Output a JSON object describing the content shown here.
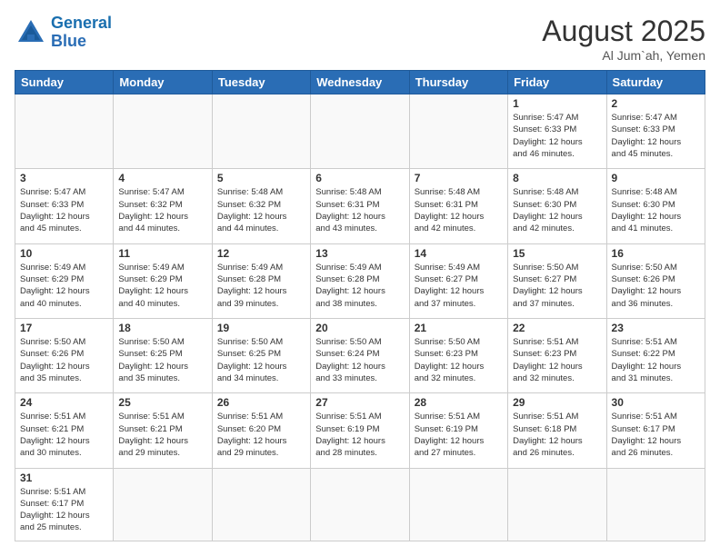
{
  "logo": {
    "text_general": "General",
    "text_blue": "Blue"
  },
  "header": {
    "month": "August 2025",
    "location": "Al Jum`ah, Yemen"
  },
  "weekdays": [
    "Sunday",
    "Monday",
    "Tuesday",
    "Wednesday",
    "Thursday",
    "Friday",
    "Saturday"
  ],
  "weeks": [
    [
      {
        "day": "",
        "info": ""
      },
      {
        "day": "",
        "info": ""
      },
      {
        "day": "",
        "info": ""
      },
      {
        "day": "",
        "info": ""
      },
      {
        "day": "",
        "info": ""
      },
      {
        "day": "1",
        "info": "Sunrise: 5:47 AM\nSunset: 6:33 PM\nDaylight: 12 hours\nand 46 minutes."
      },
      {
        "day": "2",
        "info": "Sunrise: 5:47 AM\nSunset: 6:33 PM\nDaylight: 12 hours\nand 45 minutes."
      }
    ],
    [
      {
        "day": "3",
        "info": "Sunrise: 5:47 AM\nSunset: 6:33 PM\nDaylight: 12 hours\nand 45 minutes."
      },
      {
        "day": "4",
        "info": "Sunrise: 5:47 AM\nSunset: 6:32 PM\nDaylight: 12 hours\nand 44 minutes."
      },
      {
        "day": "5",
        "info": "Sunrise: 5:48 AM\nSunset: 6:32 PM\nDaylight: 12 hours\nand 44 minutes."
      },
      {
        "day": "6",
        "info": "Sunrise: 5:48 AM\nSunset: 6:31 PM\nDaylight: 12 hours\nand 43 minutes."
      },
      {
        "day": "7",
        "info": "Sunrise: 5:48 AM\nSunset: 6:31 PM\nDaylight: 12 hours\nand 42 minutes."
      },
      {
        "day": "8",
        "info": "Sunrise: 5:48 AM\nSunset: 6:30 PM\nDaylight: 12 hours\nand 42 minutes."
      },
      {
        "day": "9",
        "info": "Sunrise: 5:48 AM\nSunset: 6:30 PM\nDaylight: 12 hours\nand 41 minutes."
      }
    ],
    [
      {
        "day": "10",
        "info": "Sunrise: 5:49 AM\nSunset: 6:29 PM\nDaylight: 12 hours\nand 40 minutes."
      },
      {
        "day": "11",
        "info": "Sunrise: 5:49 AM\nSunset: 6:29 PM\nDaylight: 12 hours\nand 40 minutes."
      },
      {
        "day": "12",
        "info": "Sunrise: 5:49 AM\nSunset: 6:28 PM\nDaylight: 12 hours\nand 39 minutes."
      },
      {
        "day": "13",
        "info": "Sunrise: 5:49 AM\nSunset: 6:28 PM\nDaylight: 12 hours\nand 38 minutes."
      },
      {
        "day": "14",
        "info": "Sunrise: 5:49 AM\nSunset: 6:27 PM\nDaylight: 12 hours\nand 37 minutes."
      },
      {
        "day": "15",
        "info": "Sunrise: 5:50 AM\nSunset: 6:27 PM\nDaylight: 12 hours\nand 37 minutes."
      },
      {
        "day": "16",
        "info": "Sunrise: 5:50 AM\nSunset: 6:26 PM\nDaylight: 12 hours\nand 36 minutes."
      }
    ],
    [
      {
        "day": "17",
        "info": "Sunrise: 5:50 AM\nSunset: 6:26 PM\nDaylight: 12 hours\nand 35 minutes."
      },
      {
        "day": "18",
        "info": "Sunrise: 5:50 AM\nSunset: 6:25 PM\nDaylight: 12 hours\nand 35 minutes."
      },
      {
        "day": "19",
        "info": "Sunrise: 5:50 AM\nSunset: 6:25 PM\nDaylight: 12 hours\nand 34 minutes."
      },
      {
        "day": "20",
        "info": "Sunrise: 5:50 AM\nSunset: 6:24 PM\nDaylight: 12 hours\nand 33 minutes."
      },
      {
        "day": "21",
        "info": "Sunrise: 5:50 AM\nSunset: 6:23 PM\nDaylight: 12 hours\nand 32 minutes."
      },
      {
        "day": "22",
        "info": "Sunrise: 5:51 AM\nSunset: 6:23 PM\nDaylight: 12 hours\nand 32 minutes."
      },
      {
        "day": "23",
        "info": "Sunrise: 5:51 AM\nSunset: 6:22 PM\nDaylight: 12 hours\nand 31 minutes."
      }
    ],
    [
      {
        "day": "24",
        "info": "Sunrise: 5:51 AM\nSunset: 6:21 PM\nDaylight: 12 hours\nand 30 minutes."
      },
      {
        "day": "25",
        "info": "Sunrise: 5:51 AM\nSunset: 6:21 PM\nDaylight: 12 hours\nand 29 minutes."
      },
      {
        "day": "26",
        "info": "Sunrise: 5:51 AM\nSunset: 6:20 PM\nDaylight: 12 hours\nand 29 minutes."
      },
      {
        "day": "27",
        "info": "Sunrise: 5:51 AM\nSunset: 6:19 PM\nDaylight: 12 hours\nand 28 minutes."
      },
      {
        "day": "28",
        "info": "Sunrise: 5:51 AM\nSunset: 6:19 PM\nDaylight: 12 hours\nand 27 minutes."
      },
      {
        "day": "29",
        "info": "Sunrise: 5:51 AM\nSunset: 6:18 PM\nDaylight: 12 hours\nand 26 minutes."
      },
      {
        "day": "30",
        "info": "Sunrise: 5:51 AM\nSunset: 6:17 PM\nDaylight: 12 hours\nand 26 minutes."
      }
    ],
    [
      {
        "day": "31",
        "info": "Sunrise: 5:51 AM\nSunset: 6:17 PM\nDaylight: 12 hours\nand 25 minutes."
      },
      {
        "day": "",
        "info": ""
      },
      {
        "day": "",
        "info": ""
      },
      {
        "day": "",
        "info": ""
      },
      {
        "day": "",
        "info": ""
      },
      {
        "day": "",
        "info": ""
      },
      {
        "day": "",
        "info": ""
      }
    ]
  ]
}
